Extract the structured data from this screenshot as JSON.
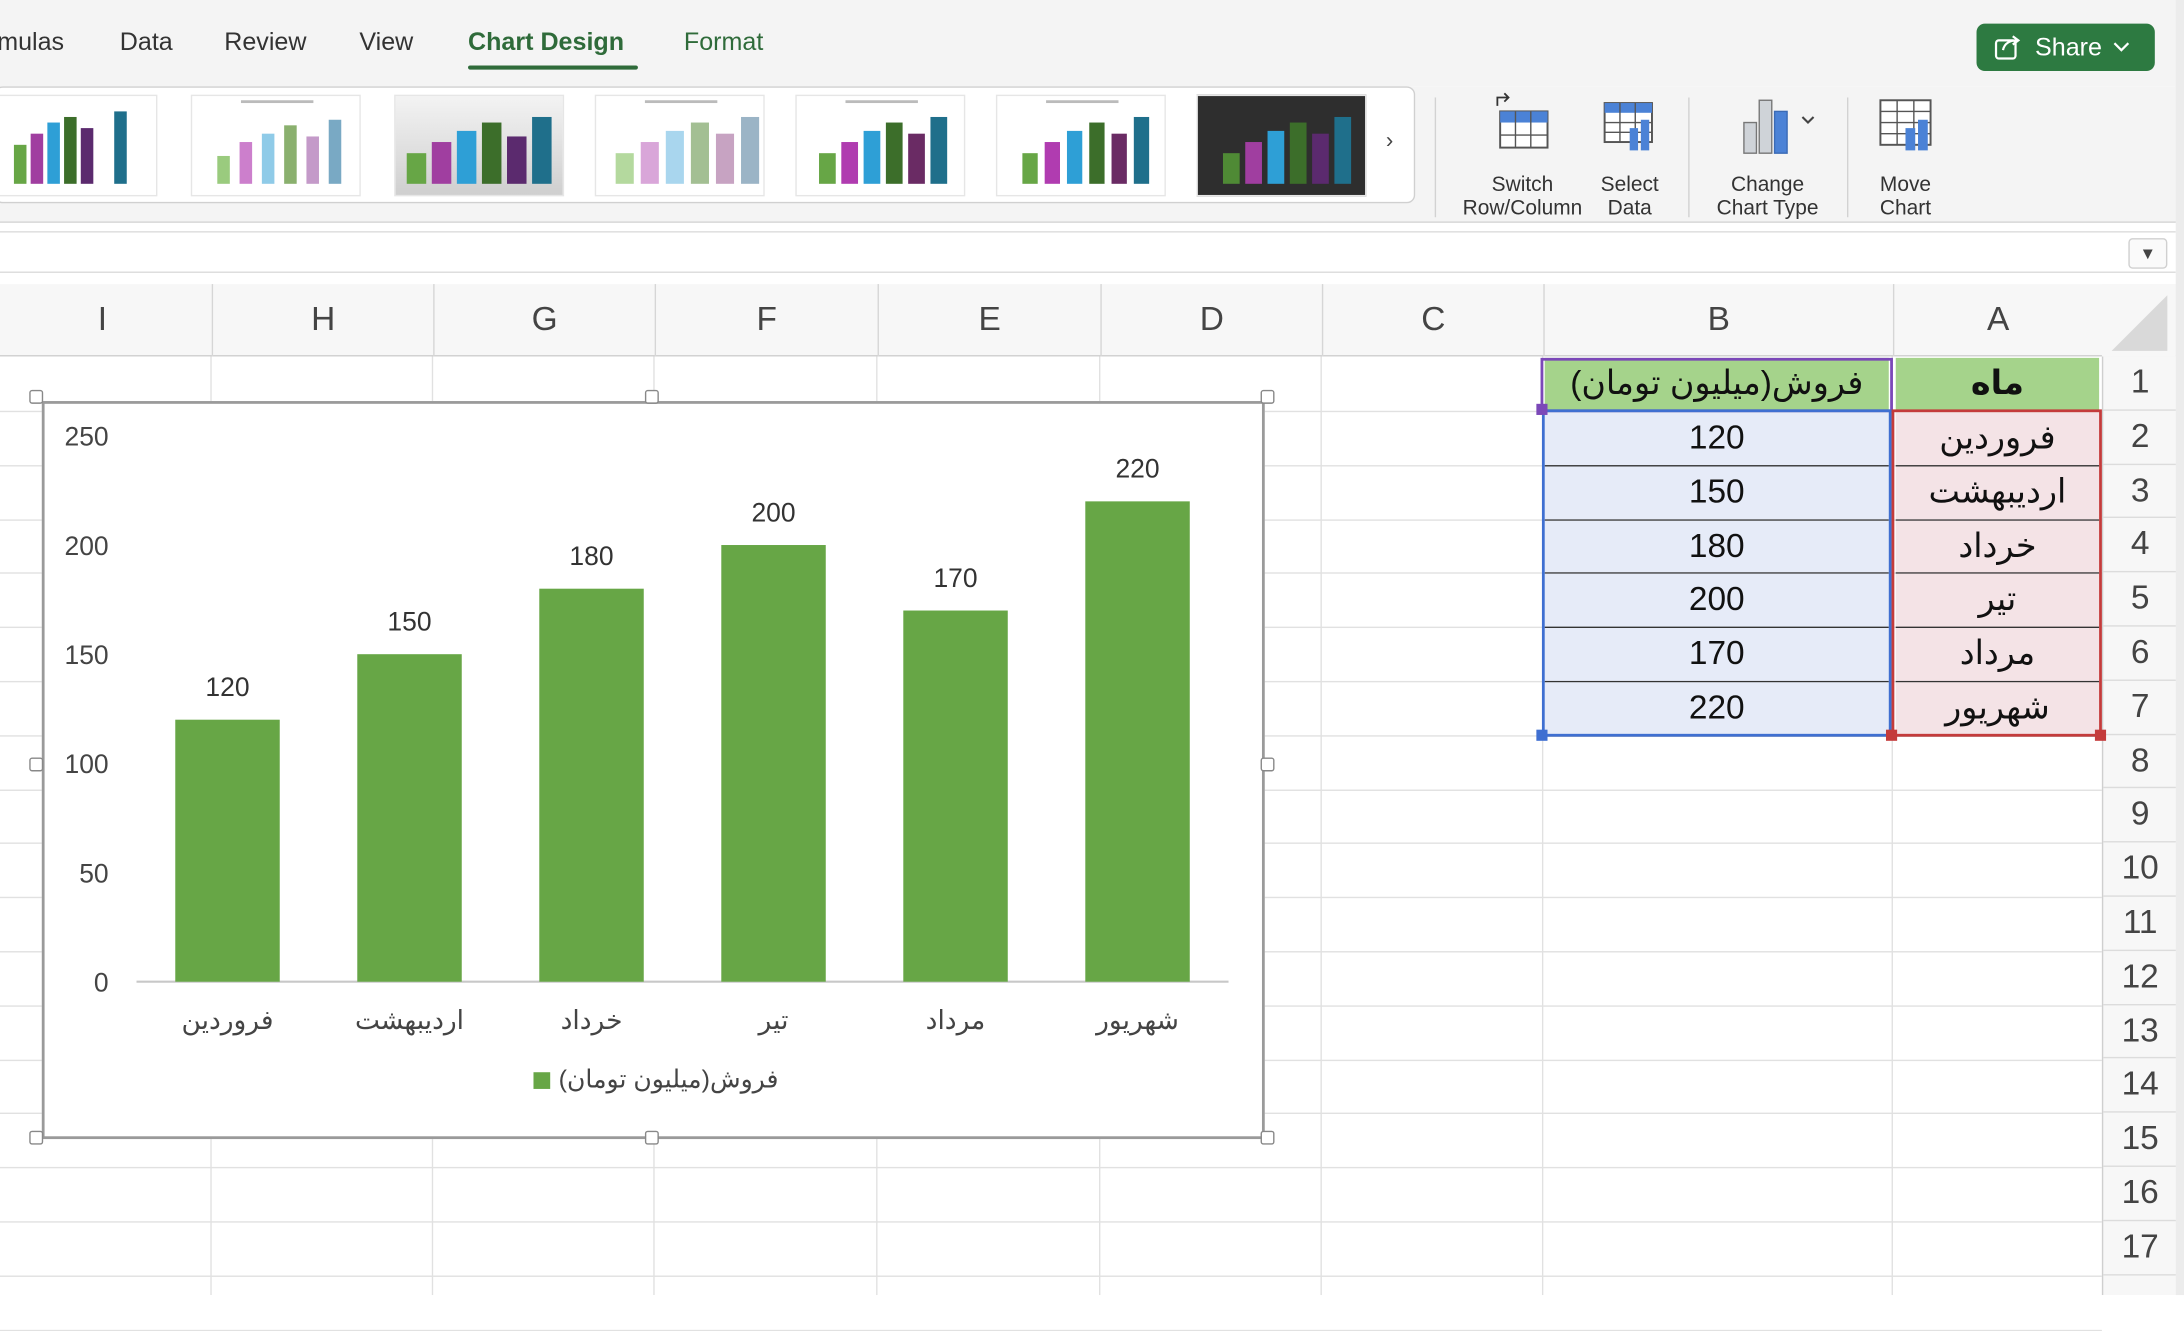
{
  "ribbon": {
    "tabs": [
      "mulas",
      "Data",
      "Review",
      "View",
      "Chart Design",
      "Format"
    ],
    "active_tab": "Chart Design",
    "share_label": "Share",
    "buttons": {
      "switch": [
        "Switch",
        "Row/Column"
      ],
      "select": [
        "Select",
        "Data"
      ],
      "change": [
        "Change",
        "Chart Type"
      ],
      "move": [
        "Move",
        "Chart"
      ]
    },
    "gallery_arrow": "›"
  },
  "formula_bar": {
    "dropdown_glyph": "▼"
  },
  "sheet": {
    "columns": [
      "I",
      "H",
      "G",
      "F",
      "E",
      "D",
      "C",
      "B",
      "A"
    ],
    "rows": [
      "1",
      "2",
      "3",
      "4",
      "5",
      "6",
      "7",
      "8",
      "9",
      "10",
      "11",
      "12",
      "13",
      "14",
      "15",
      "16",
      "17"
    ],
    "table": {
      "header_a": "ماه",
      "header_b": "فروش(میلیون تومان)",
      "months": [
        "فروردین",
        "اردیبهشت",
        "خرداد",
        "تیر",
        "مرداد",
        "شهریور"
      ],
      "values": [
        "120",
        "150",
        "180",
        "200",
        "170",
        "220"
      ]
    }
  },
  "colors": {
    "accent": "#2f6b3a",
    "bar": "#67a646",
    "header_fill": "#a5d38b",
    "col_a_fill": "#f4e3e6",
    "col_b_fill": "#e6ebf8"
  },
  "chart_data": {
    "type": "bar",
    "categories": [
      "فروردین",
      "اردیبهشت",
      "خرداد",
      "تیر",
      "مرداد",
      "شهریور"
    ],
    "series": [
      {
        "name": "فروش(میلیون تومان)",
        "values": [
          120,
          150,
          180,
          200,
          170,
          220
        ],
        "color": "#67a646"
      }
    ],
    "ylim": [
      0,
      250
    ],
    "yticks": [
      0,
      50,
      100,
      150,
      200,
      250
    ],
    "data_labels": true,
    "grid": false,
    "legend": "bottom"
  }
}
